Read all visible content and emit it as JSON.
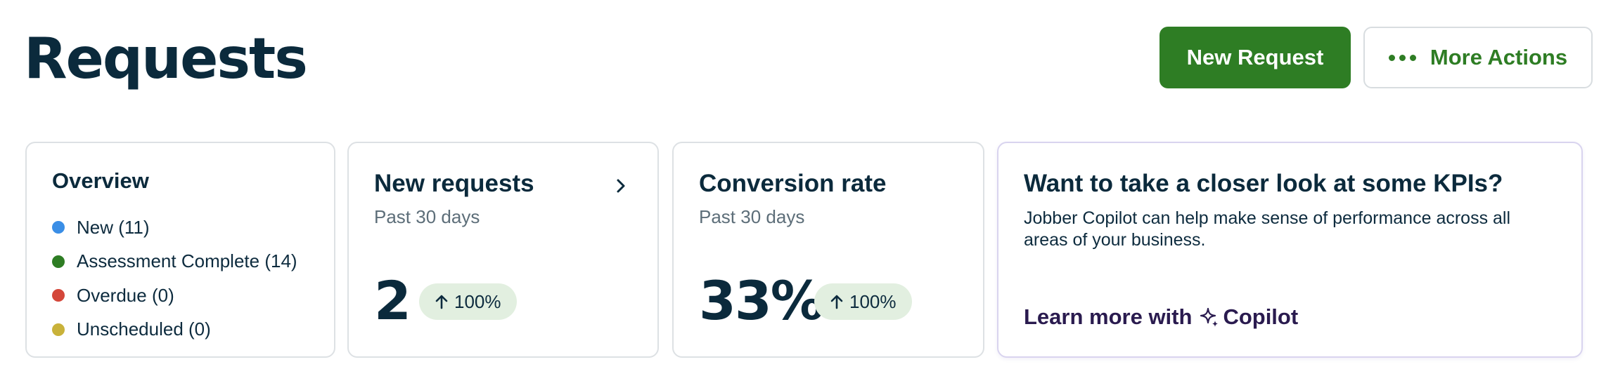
{
  "header": {
    "title": "Requests",
    "new_request_label": "New Request",
    "more_actions_label": "More Actions"
  },
  "overview": {
    "title": "Overview",
    "items": [
      {
        "label": "New (11)",
        "color": "#3a8ee6"
      },
      {
        "label": "Assessment Complete (14)",
        "color": "#2e7d24"
      },
      {
        "label": "Overdue (0)",
        "color": "#d4473a"
      },
      {
        "label": "Unscheduled (0)",
        "color": "#c9b23a"
      }
    ]
  },
  "new_requests": {
    "title": "New requests",
    "subtitle": "Past 30 days",
    "value": "2",
    "change": "100%"
  },
  "conversion_rate": {
    "title": "Conversion rate",
    "subtitle": "Past 30 days",
    "value": "33%",
    "change": "100%"
  },
  "kpi_promo": {
    "title": "Want to take a closer look at some KPIs?",
    "body": "Jobber Copilot can help make sense of performance across all areas of your business.",
    "link_prefix": "Learn more with",
    "link_brand": "Copilot"
  },
  "colors": {
    "primary": "#2e7d24",
    "heading": "#0b2a3c",
    "pill_bg": "#e2efe0"
  }
}
